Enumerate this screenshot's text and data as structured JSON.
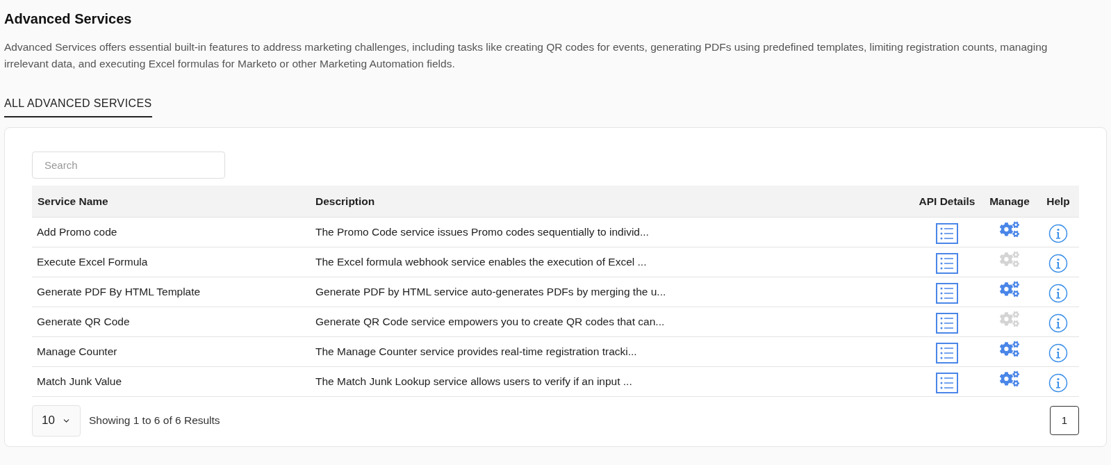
{
  "page": {
    "title": "Advanced Services",
    "description": "Advanced Services offers essential built-in features to address marketing challenges, including tasks like creating QR codes for events, generating PDFs using predefined templates, limiting registration counts, managing irrelevant data, and executing Excel formulas for Marketo or other Marketing Automation fields."
  },
  "tabs": [
    {
      "label": "ALL ADVANCED SERVICES",
      "selected": true
    }
  ],
  "search": {
    "placeholder": "Search"
  },
  "table": {
    "columns": [
      "Service Name",
      "Description",
      "API Details",
      "Manage",
      "Help"
    ],
    "rows": [
      {
        "name": "Add Promo code",
        "description": "The Promo Code service issues Promo codes sequentially to individ...",
        "manage_enabled": true
      },
      {
        "name": "Execute Excel Formula",
        "description": "The Excel formula webhook service enables the execution of Excel ...",
        "manage_enabled": false
      },
      {
        "name": "Generate PDF By HTML Template",
        "description": "Generate PDF by HTML service auto-generates PDFs by merging the u...",
        "manage_enabled": true
      },
      {
        "name": "Generate QR Code",
        "description": "Generate QR Code service empowers you to create QR codes that can...",
        "manage_enabled": false
      },
      {
        "name": "Manage Counter",
        "description": "The Manage Counter service provides real-time registration tracki...",
        "manage_enabled": true
      },
      {
        "name": "Match Junk Value",
        "description": "The Match Junk Lookup service allows users to verify if an input ...",
        "manage_enabled": true
      }
    ]
  },
  "pagination": {
    "page_size": "10",
    "summary": "Showing 1 to 6 of 6 Results",
    "pages": [
      {
        "label": "1",
        "selected": true
      }
    ]
  }
}
